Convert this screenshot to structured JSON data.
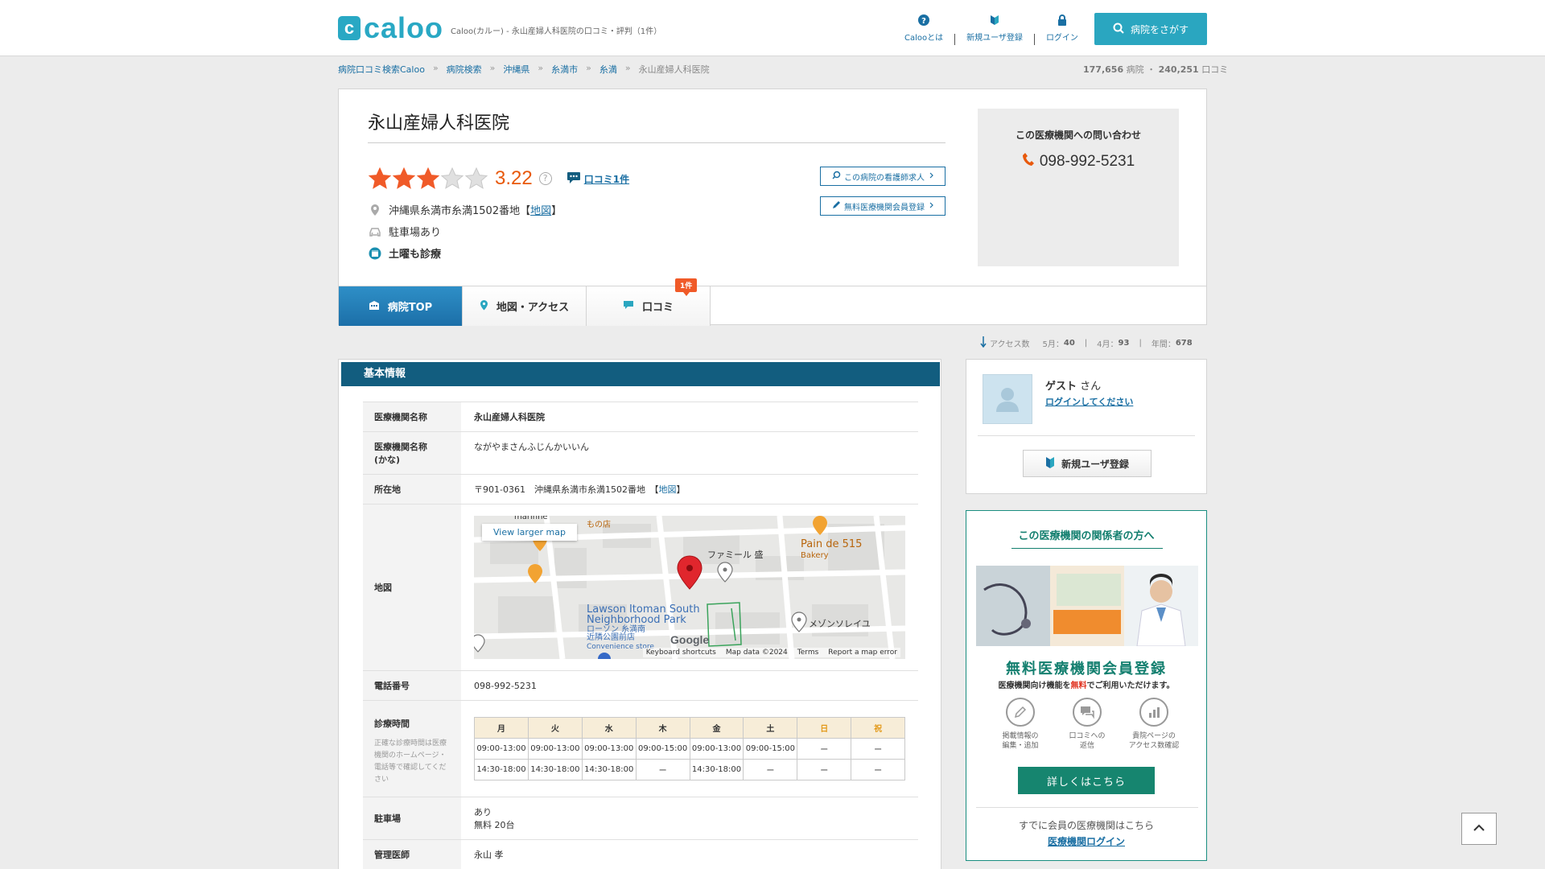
{
  "header": {
    "logo_mark": "c",
    "logo_text": "caloo",
    "description": "Caloo(カルー) - 永山産婦人科医院の口コミ・評判（1件）",
    "nav": [
      {
        "label": "Calooとは",
        "icon": "question-icon"
      },
      {
        "label": "新規ユーザ登録",
        "icon": "beginner-leaf-icon"
      },
      {
        "label": "ログイン",
        "icon": "lock-icon"
      }
    ],
    "search_button": "病院をさがす"
  },
  "breadcrumb": {
    "items": [
      "病院口コミ検索Caloo",
      "病院検索",
      "沖縄県",
      "糸満市",
      "糸満"
    ],
    "separator": "»",
    "current": "永山産婦人科医院"
  },
  "site_stats": {
    "hospitals": "177,656",
    "hospitals_label": "病院",
    "dot": "・",
    "reviews": "240,251",
    "reviews_label": "口コミ"
  },
  "hospital": {
    "name": "永山産婦人科医院",
    "rating_value": 3.22,
    "rating_text": "3.22",
    "filled_stars": 3,
    "total_stars": 5,
    "help": "?",
    "review_link": "口コミ1件",
    "address": "沖縄県糸満市糸満1502番地",
    "map_open": "【",
    "map_link": "地図",
    "map_close": "】",
    "parking": "駐車場あり",
    "saturday": "土曜も診療",
    "nurse_button": "この病院の看護師求人",
    "register_button": "無料医療機関会員登録"
  },
  "contact": {
    "title": "この医療機関への問い合わせ",
    "phone": "098-992-5231"
  },
  "tabs": [
    {
      "label": "病院TOP",
      "icon": "hospital-icon",
      "active": true
    },
    {
      "label": "地図・アクセス",
      "icon": "map-pin-icon",
      "active": false
    },
    {
      "label": "口コミ",
      "icon": "speech-bubble-icon",
      "active": false,
      "badge": "1件"
    }
  ],
  "access_stats": {
    "label": "アクセス数",
    "may_label": "5月：",
    "may": "40",
    "apr_label": "4月：",
    "apr": "93",
    "year_label": "年間：",
    "year": "678",
    "pipe": "|"
  },
  "basic_info": {
    "title": "基本情報",
    "rows": {
      "name_label": "医療機関名称",
      "name_value": "永山産婦人科医院",
      "kana_label": "医療機関名称\n(かな)",
      "kana_value": "ながやまさんふじんかいいん",
      "address_label": "所在地",
      "address_value": "〒901-0361　沖縄県糸満市糸満1502番地　",
      "address_map_open": "【",
      "address_map_link": "地図",
      "address_map_close": "】",
      "map_label": "地図",
      "phone_label": "電話番号",
      "phone_value": "098-992-5231",
      "hours_label": "診療時間",
      "hours_note": "正確な診療時間は医療機関のホームページ・電話等で確認してください",
      "parking_label": "駐車場",
      "parking_line1": "あり",
      "parking_line2": "無料 20台",
      "director_label": "管理医師",
      "director_value": "永山 孝"
    }
  },
  "map": {
    "larger_map": "View larger map",
    "labels": {
      "famiru": "ファミール 盛",
      "pain": "Pain de 515",
      "bakery": "Bakery",
      "lawson1": "Lawson Itoman South",
      "lawson2": "Neighborhood Park",
      "lawson_jp1": "ローソン 糸満南",
      "lawson_jp2": "近隣公園前店",
      "convenience": "Convenience store",
      "maison": "メゾンソレイユ",
      "shop_top": "marinne",
      "shop_jp": "もの店"
    },
    "google": "Google",
    "footer": [
      "Keyboard shortcuts",
      "Map data ©2024",
      "Terms",
      "Report a map error"
    ]
  },
  "hours": {
    "days": [
      "月",
      "火",
      "水",
      "木",
      "金",
      "土",
      "日",
      "祝"
    ],
    "holiday_columns": [
      6,
      7
    ],
    "morning": [
      "09:00-13:00",
      "09:00-13:00",
      "09:00-13:00",
      "09:00-15:00",
      "09:00-13:00",
      "09:00-15:00",
      "ー",
      "ー"
    ],
    "afternoon": [
      "14:30-18:00",
      "14:30-18:00",
      "14:30-18:00",
      "ー",
      "14:30-18:00",
      "ー",
      "ー",
      "ー"
    ]
  },
  "user": {
    "guest": "ゲスト",
    "honorific": " さん",
    "login_link": "ログインしてください",
    "register": "新規ユーザ登録"
  },
  "promo": {
    "title": "この医療機関の関係者の方へ",
    "headline": "無料医療機関会員登録",
    "sub_before": "医療機関向け機能を",
    "sub_red": "無料",
    "sub_after": "でご利用いただけます。",
    "features": [
      {
        "label": "掲載情報の\n編集・追加",
        "icon": "pencil-icon"
      },
      {
        "label": "口コミへの\n返信",
        "icon": "reply-bubble-icon"
      },
      {
        "label": "貴院ページの\nアクセス数確認",
        "icon": "bar-chart-icon"
      }
    ],
    "detail_button": "詳しくはこちら",
    "member_text": "すでに会員の医療機関はこちら",
    "member_login": "医療機関ログイン"
  },
  "colors": {
    "brand": "#29a8c4",
    "star": "#f05a28",
    "score": "#e8590c",
    "section_header": "#125d7f",
    "promo_green": "#137f6f"
  }
}
